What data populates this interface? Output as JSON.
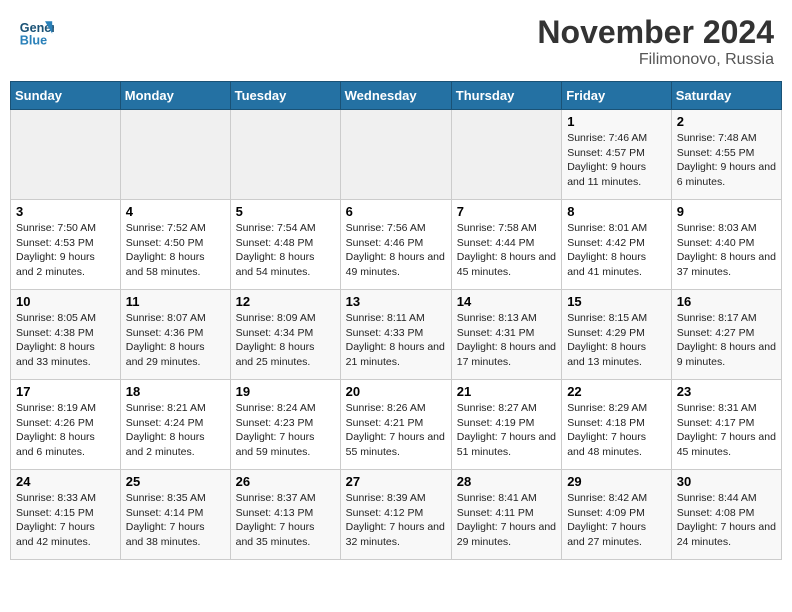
{
  "header": {
    "logo_line1": "General",
    "logo_line2": "Blue",
    "month": "November 2024",
    "location": "Filimonovo, Russia"
  },
  "weekdays": [
    "Sunday",
    "Monday",
    "Tuesday",
    "Wednesday",
    "Thursday",
    "Friday",
    "Saturday"
  ],
  "weeks": [
    [
      {
        "day": "",
        "info": ""
      },
      {
        "day": "",
        "info": ""
      },
      {
        "day": "",
        "info": ""
      },
      {
        "day": "",
        "info": ""
      },
      {
        "day": "",
        "info": ""
      },
      {
        "day": "1",
        "info": "Sunrise: 7:46 AM\nSunset: 4:57 PM\nDaylight: 9 hours and 11 minutes."
      },
      {
        "day": "2",
        "info": "Sunrise: 7:48 AM\nSunset: 4:55 PM\nDaylight: 9 hours and 6 minutes."
      }
    ],
    [
      {
        "day": "3",
        "info": "Sunrise: 7:50 AM\nSunset: 4:53 PM\nDaylight: 9 hours and 2 minutes."
      },
      {
        "day": "4",
        "info": "Sunrise: 7:52 AM\nSunset: 4:50 PM\nDaylight: 8 hours and 58 minutes."
      },
      {
        "day": "5",
        "info": "Sunrise: 7:54 AM\nSunset: 4:48 PM\nDaylight: 8 hours and 54 minutes."
      },
      {
        "day": "6",
        "info": "Sunrise: 7:56 AM\nSunset: 4:46 PM\nDaylight: 8 hours and 49 minutes."
      },
      {
        "day": "7",
        "info": "Sunrise: 7:58 AM\nSunset: 4:44 PM\nDaylight: 8 hours and 45 minutes."
      },
      {
        "day": "8",
        "info": "Sunrise: 8:01 AM\nSunset: 4:42 PM\nDaylight: 8 hours and 41 minutes."
      },
      {
        "day": "9",
        "info": "Sunrise: 8:03 AM\nSunset: 4:40 PM\nDaylight: 8 hours and 37 minutes."
      }
    ],
    [
      {
        "day": "10",
        "info": "Sunrise: 8:05 AM\nSunset: 4:38 PM\nDaylight: 8 hours and 33 minutes."
      },
      {
        "day": "11",
        "info": "Sunrise: 8:07 AM\nSunset: 4:36 PM\nDaylight: 8 hours and 29 minutes."
      },
      {
        "day": "12",
        "info": "Sunrise: 8:09 AM\nSunset: 4:34 PM\nDaylight: 8 hours and 25 minutes."
      },
      {
        "day": "13",
        "info": "Sunrise: 8:11 AM\nSunset: 4:33 PM\nDaylight: 8 hours and 21 minutes."
      },
      {
        "day": "14",
        "info": "Sunrise: 8:13 AM\nSunset: 4:31 PM\nDaylight: 8 hours and 17 minutes."
      },
      {
        "day": "15",
        "info": "Sunrise: 8:15 AM\nSunset: 4:29 PM\nDaylight: 8 hours and 13 minutes."
      },
      {
        "day": "16",
        "info": "Sunrise: 8:17 AM\nSunset: 4:27 PM\nDaylight: 8 hours and 9 minutes."
      }
    ],
    [
      {
        "day": "17",
        "info": "Sunrise: 8:19 AM\nSunset: 4:26 PM\nDaylight: 8 hours and 6 minutes."
      },
      {
        "day": "18",
        "info": "Sunrise: 8:21 AM\nSunset: 4:24 PM\nDaylight: 8 hours and 2 minutes."
      },
      {
        "day": "19",
        "info": "Sunrise: 8:24 AM\nSunset: 4:23 PM\nDaylight: 7 hours and 59 minutes."
      },
      {
        "day": "20",
        "info": "Sunrise: 8:26 AM\nSunset: 4:21 PM\nDaylight: 7 hours and 55 minutes."
      },
      {
        "day": "21",
        "info": "Sunrise: 8:27 AM\nSunset: 4:19 PM\nDaylight: 7 hours and 51 minutes."
      },
      {
        "day": "22",
        "info": "Sunrise: 8:29 AM\nSunset: 4:18 PM\nDaylight: 7 hours and 48 minutes."
      },
      {
        "day": "23",
        "info": "Sunrise: 8:31 AM\nSunset: 4:17 PM\nDaylight: 7 hours and 45 minutes."
      }
    ],
    [
      {
        "day": "24",
        "info": "Sunrise: 8:33 AM\nSunset: 4:15 PM\nDaylight: 7 hours and 42 minutes."
      },
      {
        "day": "25",
        "info": "Sunrise: 8:35 AM\nSunset: 4:14 PM\nDaylight: 7 hours and 38 minutes."
      },
      {
        "day": "26",
        "info": "Sunrise: 8:37 AM\nSunset: 4:13 PM\nDaylight: 7 hours and 35 minutes."
      },
      {
        "day": "27",
        "info": "Sunrise: 8:39 AM\nSunset: 4:12 PM\nDaylight: 7 hours and 32 minutes."
      },
      {
        "day": "28",
        "info": "Sunrise: 8:41 AM\nSunset: 4:11 PM\nDaylight: 7 hours and 29 minutes."
      },
      {
        "day": "29",
        "info": "Sunrise: 8:42 AM\nSunset: 4:09 PM\nDaylight: 7 hours and 27 minutes."
      },
      {
        "day": "30",
        "info": "Sunrise: 8:44 AM\nSunset: 4:08 PM\nDaylight: 7 hours and 24 minutes."
      }
    ]
  ]
}
